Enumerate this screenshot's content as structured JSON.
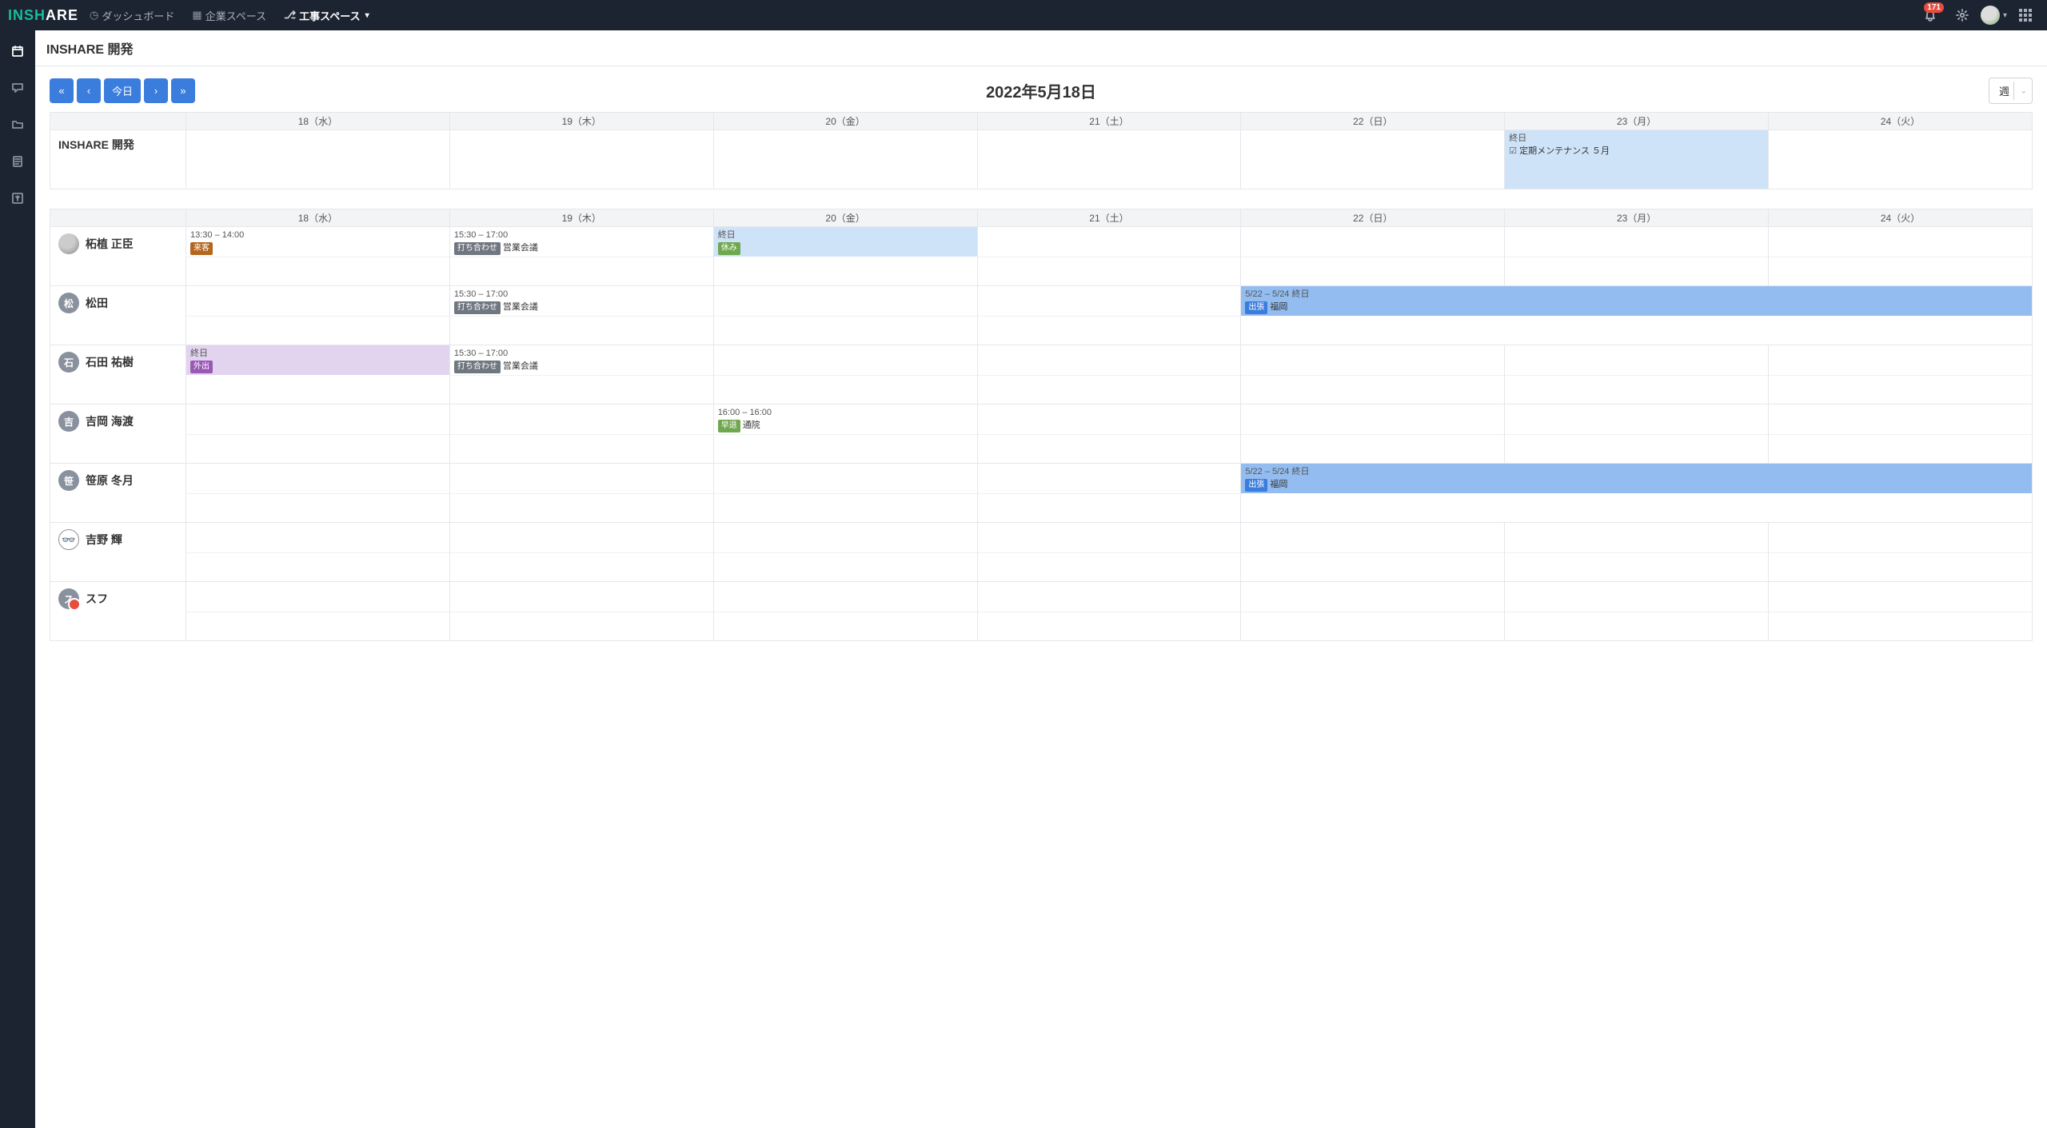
{
  "brand": {
    "part1": "INSH",
    "part2": "ARE"
  },
  "nav": {
    "dashboard": "ダッシュボード",
    "company": "企業スペース",
    "construction": "工事スペース"
  },
  "notifications": {
    "count": "171"
  },
  "page": {
    "title": "INSHARE 開発"
  },
  "calendar": {
    "today_btn": "今日",
    "title": "2022年5月18日",
    "view": "週",
    "days": [
      {
        "label": "18（水）",
        "class": ""
      },
      {
        "label": "19（木）",
        "class": ""
      },
      {
        "label": "20（金）",
        "class": ""
      },
      {
        "label": "21（土）",
        "class": "sat"
      },
      {
        "label": "22（日）",
        "class": "sun"
      },
      {
        "label": "23（月）",
        "class": ""
      },
      {
        "label": "24（火）",
        "class": ""
      }
    ]
  },
  "project_row": {
    "name": "INSHARE 開発",
    "event": {
      "day": 5,
      "time": "終日",
      "title": "定期メンテナンス ５月",
      "icon": "☑"
    }
  },
  "people": [
    {
      "name": "柘植 正臣",
      "avatar_type": "img"
    },
    {
      "name": "松田",
      "avatar_type": "txt",
      "avatar_txt": "松"
    },
    {
      "name": "石田 祐樹",
      "avatar_type": "txt",
      "avatar_txt": "石"
    },
    {
      "name": "吉岡 海渡",
      "avatar_type": "txt",
      "avatar_txt": "吉"
    },
    {
      "name": "笹原 冬月",
      "avatar_type": "txt",
      "avatar_txt": "笹"
    },
    {
      "name": "吉野 輝",
      "avatar_type": "gl",
      "avatar_txt": "👓"
    },
    {
      "name": "スフ",
      "avatar_type": "su",
      "avatar_txt": "ス"
    }
  ],
  "events": {
    "p0d0": {
      "time": "13:30 – 14:00",
      "tag": "来客",
      "tag_class": "bg-brown",
      "title": "",
      "cell_fill": ""
    },
    "p0d1": {
      "time": "15:30 – 17:00",
      "tag": "打ち合わせ",
      "tag_class": "bg-gray",
      "title": "営業会議",
      "cell_fill": ""
    },
    "p0d2": {
      "time": "終日",
      "tag": "休み",
      "tag_class": "bg-green",
      "title": "",
      "cell_fill": "fill-top fill-lightblue"
    },
    "p1d1": {
      "time": "15:30 – 17:00",
      "tag": "打ち合わせ",
      "tag_class": "bg-gray",
      "title": "営業会議",
      "cell_fill": ""
    },
    "p1d4": {
      "time": "5/22 – 5/24 終日",
      "tag": "出張",
      "tag_class": "bg-blue",
      "title": "福岡",
      "cell_fill": "fill-top fill-blue",
      "span": 3
    },
    "p2d0": {
      "time": "終日",
      "tag": "外出",
      "tag_class": "bg-purple",
      "title": "",
      "cell_fill": "fill-top fill-purple"
    },
    "p2d1": {
      "time": "15:30 – 17:00",
      "tag": "打ち合わせ",
      "tag_class": "bg-gray",
      "title": "営業会議",
      "cell_fill": ""
    },
    "p3d2": {
      "time": "16:00 – 16:00",
      "tag": "早退",
      "tag_class": "bg-green",
      "title": "通院",
      "cell_fill": ""
    },
    "p4d4": {
      "time": "5/22 – 5/24 終日",
      "tag": "出張",
      "tag_class": "bg-blue",
      "title": "福岡",
      "cell_fill": "fill-top fill-blue",
      "span": 3
    }
  }
}
